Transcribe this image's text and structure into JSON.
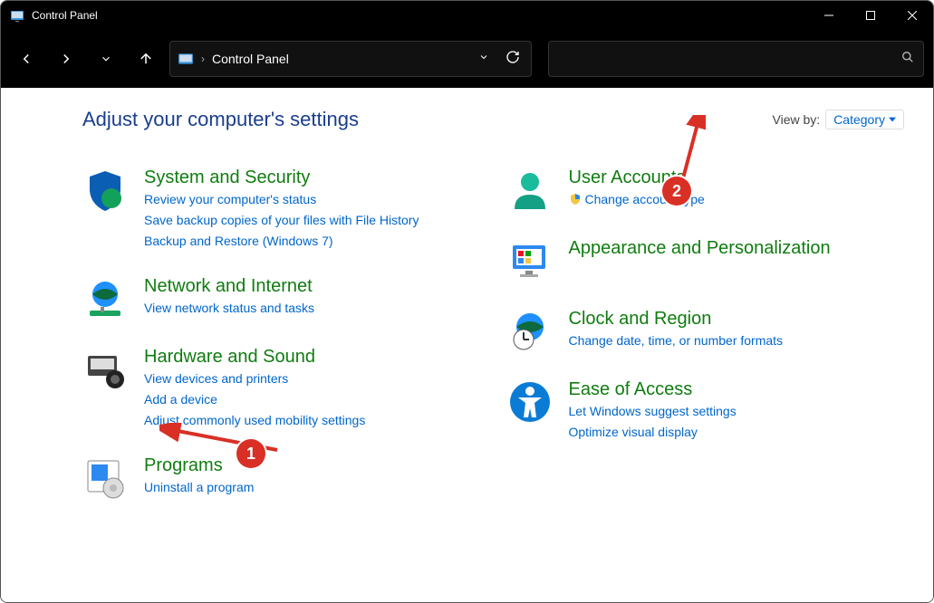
{
  "window": {
    "title": "Control Panel"
  },
  "address": {
    "path": "Control Panel"
  },
  "page": {
    "heading": "Adjust your computer's settings",
    "viewby_label": "View by:",
    "viewby_value": "Category"
  },
  "left_categories": [
    {
      "title": "System and Security",
      "links": [
        "Review your computer's status",
        "Save backup copies of your files with File History",
        "Backup and Restore (Windows 7)"
      ],
      "shield_links": []
    },
    {
      "title": "Network and Internet",
      "links": [
        "View network status and tasks"
      ],
      "shield_links": []
    },
    {
      "title": "Hardware and Sound",
      "links": [
        "View devices and printers",
        "Add a device",
        "Adjust commonly used mobility settings"
      ],
      "shield_links": []
    },
    {
      "title": "Programs",
      "links": [
        "Uninstall a program"
      ],
      "shield_links": []
    }
  ],
  "right_categories": [
    {
      "title": "User Accounts",
      "links": [
        "Change account type"
      ],
      "shield_links": [
        0
      ]
    },
    {
      "title": "Appearance and Personalization",
      "links": [],
      "shield_links": []
    },
    {
      "title": "Clock and Region",
      "links": [
        "Change date, time, or number formats"
      ],
      "shield_links": []
    },
    {
      "title": "Ease of Access",
      "links": [
        "Let Windows suggest settings",
        "Optimize visual display"
      ],
      "shield_links": []
    }
  ],
  "annotations": {
    "1": "1",
    "2": "2"
  }
}
